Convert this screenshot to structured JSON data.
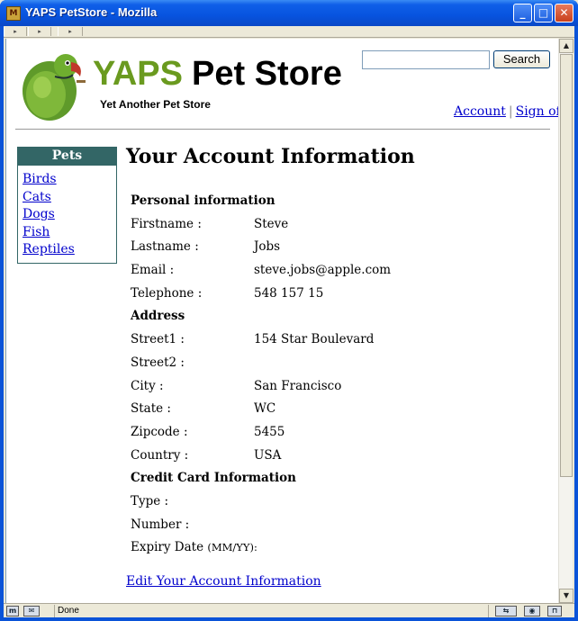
{
  "window": {
    "title": "YAPS PetStore - Mozilla",
    "icon": "browser-app-icon"
  },
  "header": {
    "brand_yaps": "YAPS",
    "brand_rest": "Pet Store",
    "tagline": "Yet Another Pet Store",
    "search_value": "",
    "search_button": "Search",
    "link_account": "Account",
    "link_separator": "|",
    "link_signoff": "Sign off",
    "brand_color": "#6a9a1f",
    "logo": "parrot-logo"
  },
  "sidebar": {
    "title": "Pets",
    "items": [
      "Birds",
      "Cats",
      "Dogs",
      "Fish",
      "Reptiles"
    ]
  },
  "main": {
    "title": "Your Account Information",
    "personal_heading": "Personal information",
    "firstname_label": "Firstname :",
    "firstname": "Steve",
    "lastname_label": "Lastname :",
    "lastname": "Jobs",
    "email_label": "Email :",
    "email": "steve.jobs@apple.com",
    "telephone_label": "Telephone :",
    "telephone": "548 157 15",
    "address_heading": "Address",
    "street1_label": "Street1 :",
    "street1": "154 Star Boulevard",
    "street2_label": "Street2 :",
    "street2": "",
    "city_label": "City :",
    "city": "San Francisco",
    "state_label": "State :",
    "state": "WC",
    "zipcode_label": "Zipcode :",
    "zipcode": "5455",
    "country_label": "Country :",
    "country": "USA",
    "cc_heading": "Credit Card Information",
    "type_label": "Type :",
    "type": "",
    "number_label": "Number :",
    "number": "",
    "expiry_label": "Expiry Date",
    "expiry_format": "(MM/YY):",
    "expiry": "",
    "edit_link": "Edit Your Account Information"
  },
  "status": {
    "text": "Done"
  }
}
